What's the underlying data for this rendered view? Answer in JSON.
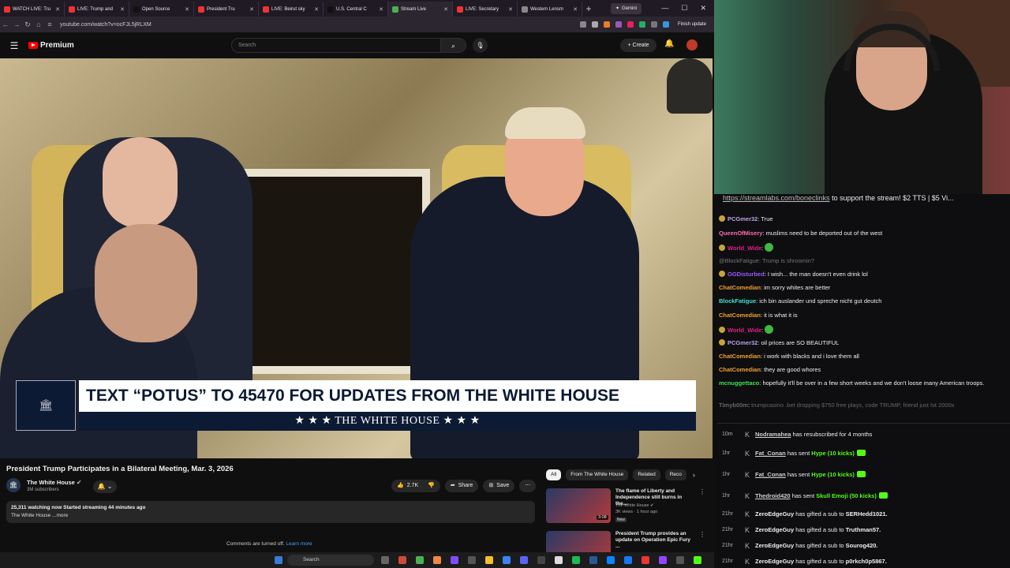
{
  "browser": {
    "tabs": [
      {
        "label": "WATCH LIVE: Tru",
        "color": "#e33"
      },
      {
        "label": "LIVE: Trump and",
        "color": "#e33"
      },
      {
        "label": "Open Source",
        "color": "#111"
      },
      {
        "label": "President Tru",
        "color": "#e33"
      },
      {
        "label": "LIVE: Beirut sky",
        "color": "#e33"
      },
      {
        "label": "U.S. Central C",
        "color": "#111"
      },
      {
        "label": "Stream Live",
        "color": "#4caf50"
      },
      {
        "label": "LIVE: Secretary",
        "color": "#e33"
      },
      {
        "label": "Western Lensm",
        "color": "#888"
      }
    ],
    "gemini_label": "Gemini",
    "url": "youtube.com/watch?v=ocFJL5jRLXM",
    "finish_update_label": "Finish update"
  },
  "youtube": {
    "logo_label": "Premium",
    "search_placeholder": "Search",
    "create_label": "Create",
    "video_title": "President Trump Participates in a Bilateral Meeting, Mar. 3, 2026",
    "channel_name": "The White House",
    "subscribers": "3M subscribers",
    "likes": "2.7K",
    "share_label": "Share",
    "save_label": "Save",
    "description_stats": "25,311 watching now  Started streaming 44 minutes ago",
    "description_text": "The White House ...more",
    "comments_off": "Comments are turned off.",
    "learn_more": "Learn more",
    "lower_third_text": "TEXT “POTUS” TO 45470 FOR UPDATES FROM THE WHITE HOUSE",
    "lower_third_banner": "★ ★ ★   THE WHITE HOUSE   ★ ★ ★",
    "chips": [
      "All",
      "From The White House",
      "Related",
      "Reco"
    ],
    "recommendations": [
      {
        "title": "The flame of Liberty and Independence still burns in the...",
        "channel": "The White House",
        "views": "3K views · 1 hour ago",
        "duration": "3:08",
        "badge": "New"
      },
      {
        "title": "President Trump provides an update on Operation Epic Fury ...",
        "channel": "",
        "views": "",
        "duration": "",
        "badge": ""
      }
    ]
  },
  "taskbar": {
    "search_placeholder": "Search"
  },
  "chat": {
    "banner_link": "https://streamlabs.com/boneclinks",
    "banner_text": " to support the stream! $2 TTS | $5 Vi...",
    "messages": [
      {
        "user": "PCGmer32",
        "text": "True",
        "color": "#b9a3e3",
        "badge": true
      },
      {
        "user": "QueenOfMisery",
        "text": "muslims need to be deported out of the west",
        "color": "#ff69b4",
        "badge": false
      },
      {
        "user": "World_Wide",
        "text": "",
        "color": "#e0218a",
        "badge": true
      },
      {
        "user": "",
        "text": "@BlockFatigue: Trump is shroomin?",
        "color": "#777",
        "badge": false
      },
      {
        "user": "OGDisturbed",
        "text": "I wish... the man doesn't even drink lol",
        "color": "#9b59ff",
        "badge": true
      },
      {
        "user": "ChatComedian",
        "text": "im sorry whites are better",
        "color": "#f0a030",
        "badge": false
      },
      {
        "user": "BlockFatigue",
        "text": "ich bin auslander und spreche nicht gut deutch",
        "color": "#3ee0d0",
        "badge": false
      },
      {
        "user": "ChatComedian",
        "text": "it is what it is",
        "color": "#f0a030",
        "badge": false
      },
      {
        "user": "World_Wide",
        "text": "",
        "color": "#e0218a",
        "badge": true
      },
      {
        "user": "PCGmer32",
        "text": "oil prices are SO BEAUTIFUL",
        "color": "#b9a3e3",
        "badge": true
      },
      {
        "user": "ChatComedian",
        "text": "i work with blacks and i love them all",
        "color": "#f0a030",
        "badge": false
      },
      {
        "user": "ChatComedian",
        "text": "they are good whores",
        "color": "#f0a030",
        "badge": false
      },
      {
        "user": "mcnuggettaco",
        "text": "hopefully it'll be over in a few short weeks and we don't loose many American troops.",
        "color": "#3ee05a",
        "badge": false
      },
      {
        "user": "Timyb00m",
        "text": "trumpcasino .bet dropping $750 free plays, code TRUMP, friend just hit 2000x",
        "color": "#666",
        "badge": false
      }
    ],
    "events": [
      {
        "time": "10m",
        "user": "Nodramahea",
        "text": "has resubscribed for 4 months",
        "hl": "",
        "kick": false
      },
      {
        "time": "1hr",
        "user": "Fat_Conan",
        "text": "has sent ",
        "hl": "Hype (10 kicks)",
        "kick": true
      },
      {
        "time": "1hr",
        "user": "Fat_Conan",
        "text": "has sent ",
        "hl": "Hype (10 kicks)",
        "kick": true
      },
      {
        "time": "1hr",
        "user": "Thedroid420",
        "text": "has sent ",
        "hl": "Skull Emoji (50 kicks)",
        "kick": true
      },
      {
        "time": "21hr",
        "user": "ZeroEdgeGuy",
        "text": "has gifted a sub to ",
        "hl": "SERHedd1021.",
        "kick": false
      },
      {
        "time": "21hr",
        "user": "ZeroEdgeGuy",
        "text": "has gifted a sub to ",
        "hl": "Truthman57.",
        "kick": false
      },
      {
        "time": "21hr",
        "user": "ZeroEdgeGuy",
        "text": "has gifted a sub to ",
        "hl": "Sourog420.",
        "kick": false
      },
      {
        "time": "21hr",
        "user": "ZeroEdgeGuy",
        "text": "has gifted a sub to ",
        "hl": "p0rkch0p5867.",
        "kick": false
      }
    ]
  }
}
